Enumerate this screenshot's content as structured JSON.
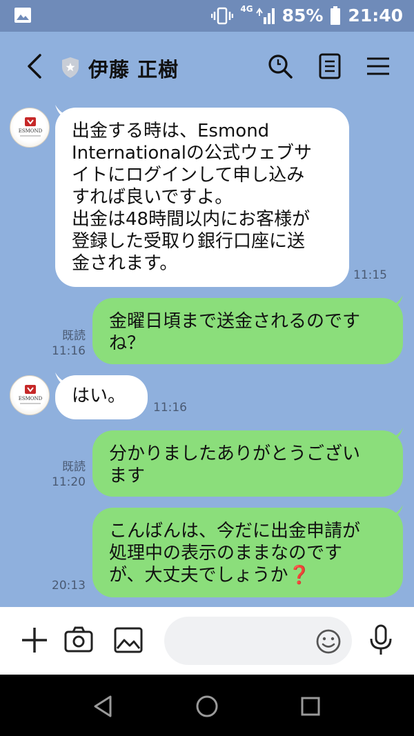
{
  "status_bar": {
    "network": "4G",
    "battery": "85%",
    "time": "21:40"
  },
  "header": {
    "title": "伊藤 正樹"
  },
  "avatar": {
    "brand": "ESMOND"
  },
  "messages": [
    {
      "side": "in",
      "text": "出金する時は、Esmond Internationalの公式ウェブサイトにログインして申し込みすれば良いですよ。\n出金は48時間以内にお客様が登録した受取り銀行口座に送金されます。",
      "time": "11:15"
    },
    {
      "side": "out",
      "text": "金曜日頃まで送金されるのですね？",
      "read": "既読",
      "time": "11:16"
    },
    {
      "side": "in",
      "text": "はい。",
      "time": "11:16"
    },
    {
      "side": "out",
      "text": "分かりましたありがとうございます",
      "read": "既読",
      "time": "11:20"
    },
    {
      "side": "out",
      "text": "こんばんは、今だに出金申請が処理中の表示のままなのですが、大丈夫でしょうか❓",
      "time": "20:13"
    }
  ],
  "input": {
    "placeholder": ""
  },
  "colors": {
    "background": "#8fb0dd",
    "status_bar": "#6f8bb9",
    "outgoing_bubble": "#8bde7b",
    "incoming_bubble": "#ffffff"
  }
}
